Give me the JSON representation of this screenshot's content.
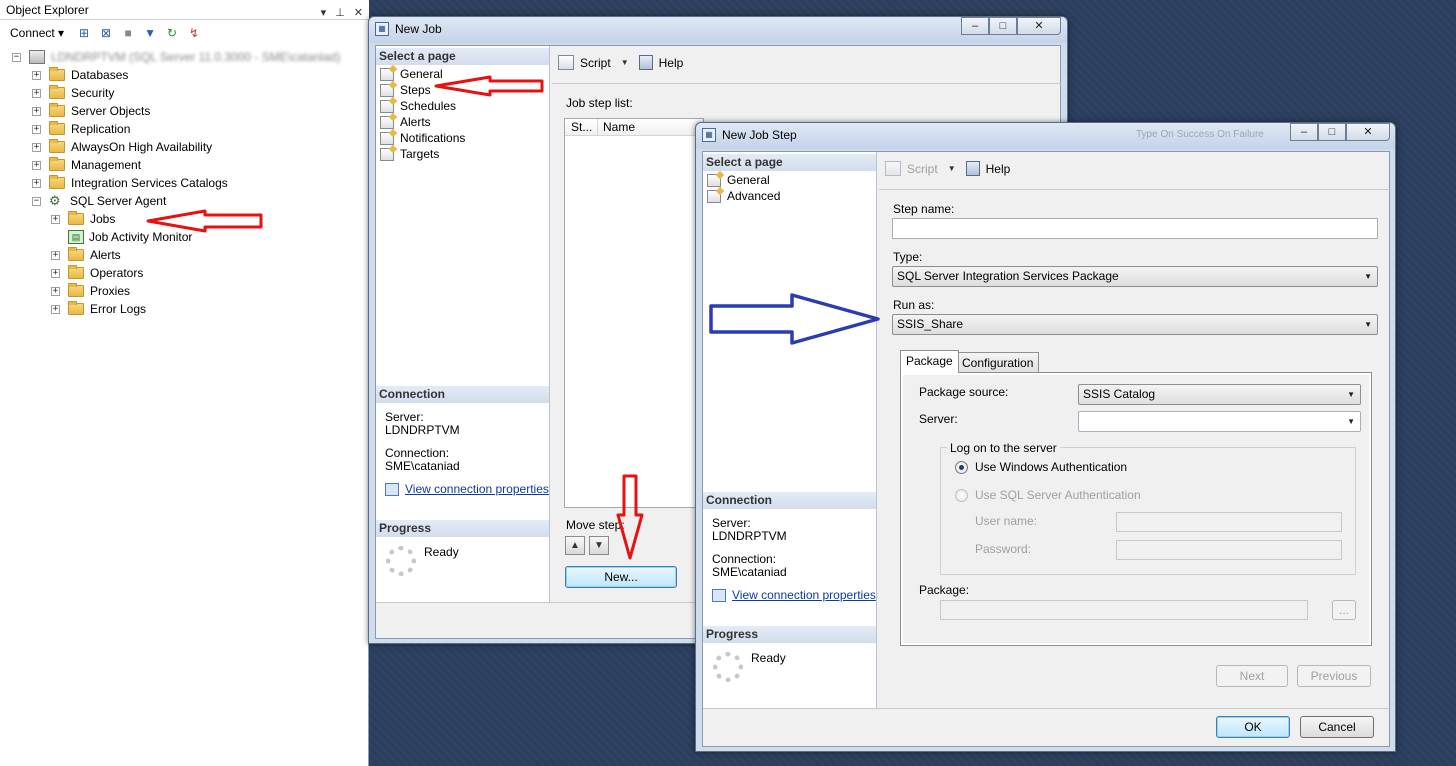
{
  "object_explorer": {
    "title": "Object Explorer",
    "title_buttons": [
      "▾",
      "⊥",
      "✕"
    ],
    "connect_label": "Connect ▾",
    "server_node": "LDNDRPTVM (SQL Server 11.0.3000 - SME\\catanlad)",
    "nodes": [
      {
        "label": "Databases"
      },
      {
        "label": "Security"
      },
      {
        "label": "Server Objects"
      },
      {
        "label": "Replication"
      },
      {
        "label": "AlwaysOn High Availability"
      },
      {
        "label": "Management"
      },
      {
        "label": "Integration Services Catalogs"
      },
      {
        "label": "SQL Server Agent"
      },
      {
        "label": "Jobs"
      },
      {
        "label": "Job Activity Monitor"
      },
      {
        "label": "Alerts"
      },
      {
        "label": "Operators"
      },
      {
        "label": "Proxies"
      },
      {
        "label": "Error Logs"
      }
    ]
  },
  "new_job": {
    "title": "New Job",
    "select_page_label": "Select a page",
    "pages": [
      "General",
      "Steps",
      "Schedules",
      "Alerts",
      "Notifications",
      "Targets"
    ],
    "toolbar": {
      "script": "Script",
      "help": "Help"
    },
    "job_step_list_label": "Job step list:",
    "columns": [
      "St...",
      "Name"
    ],
    "connection_header": "Connection",
    "server_label": "Server:",
    "server_value": "LDNDRPTVM",
    "connection_label": "Connection:",
    "connection_value": "SME\\cataniad",
    "view_props_link": "View connection properties",
    "progress_header": "Progress",
    "progress_status": "Ready",
    "move_step_label": "Move step:",
    "new_button": "New..."
  },
  "new_job_step": {
    "title": "New Job Step",
    "header_faded": "Type      On Success      On Failure",
    "select_page_label": "Select a page",
    "pages": [
      "General",
      "Advanced"
    ],
    "toolbar": {
      "script": "Script",
      "help": "Help"
    },
    "step_name_label": "Step name:",
    "step_name_value": "",
    "type_label": "Type:",
    "type_value": "SQL Server Integration Services Package",
    "run_as_label": "Run as:",
    "run_as_value": "SSIS_Share",
    "tabs": [
      "Package",
      "Configuration"
    ],
    "package_source_label": "Package source:",
    "package_source_value": "SSIS Catalog",
    "server_label": "Server:",
    "server_value": "",
    "logon_group_label": "Log on to the server",
    "windows_auth": "Use Windows Authentication",
    "sql_auth": "Use SQL Server Authentication",
    "user_name_label": "User name:",
    "password_label": "Password:",
    "package_label": "Package:",
    "browse_button": "...",
    "next_button": "Next",
    "previous_button": "Previous",
    "connection_header": "Connection",
    "conn_server_label": "Server:",
    "conn_server_value": "LDNDRPTVM",
    "conn_connection_label": "Connection:",
    "conn_connection_value": "SME\\cataniad",
    "view_props_link": "View connection properties",
    "progress_header": "Progress",
    "progress_status": "Ready",
    "ok_button": "OK",
    "cancel_button": "Cancel"
  },
  "colors": {
    "red_arrow": "#e81010",
    "blue_arrow": "#2a3cb4"
  }
}
